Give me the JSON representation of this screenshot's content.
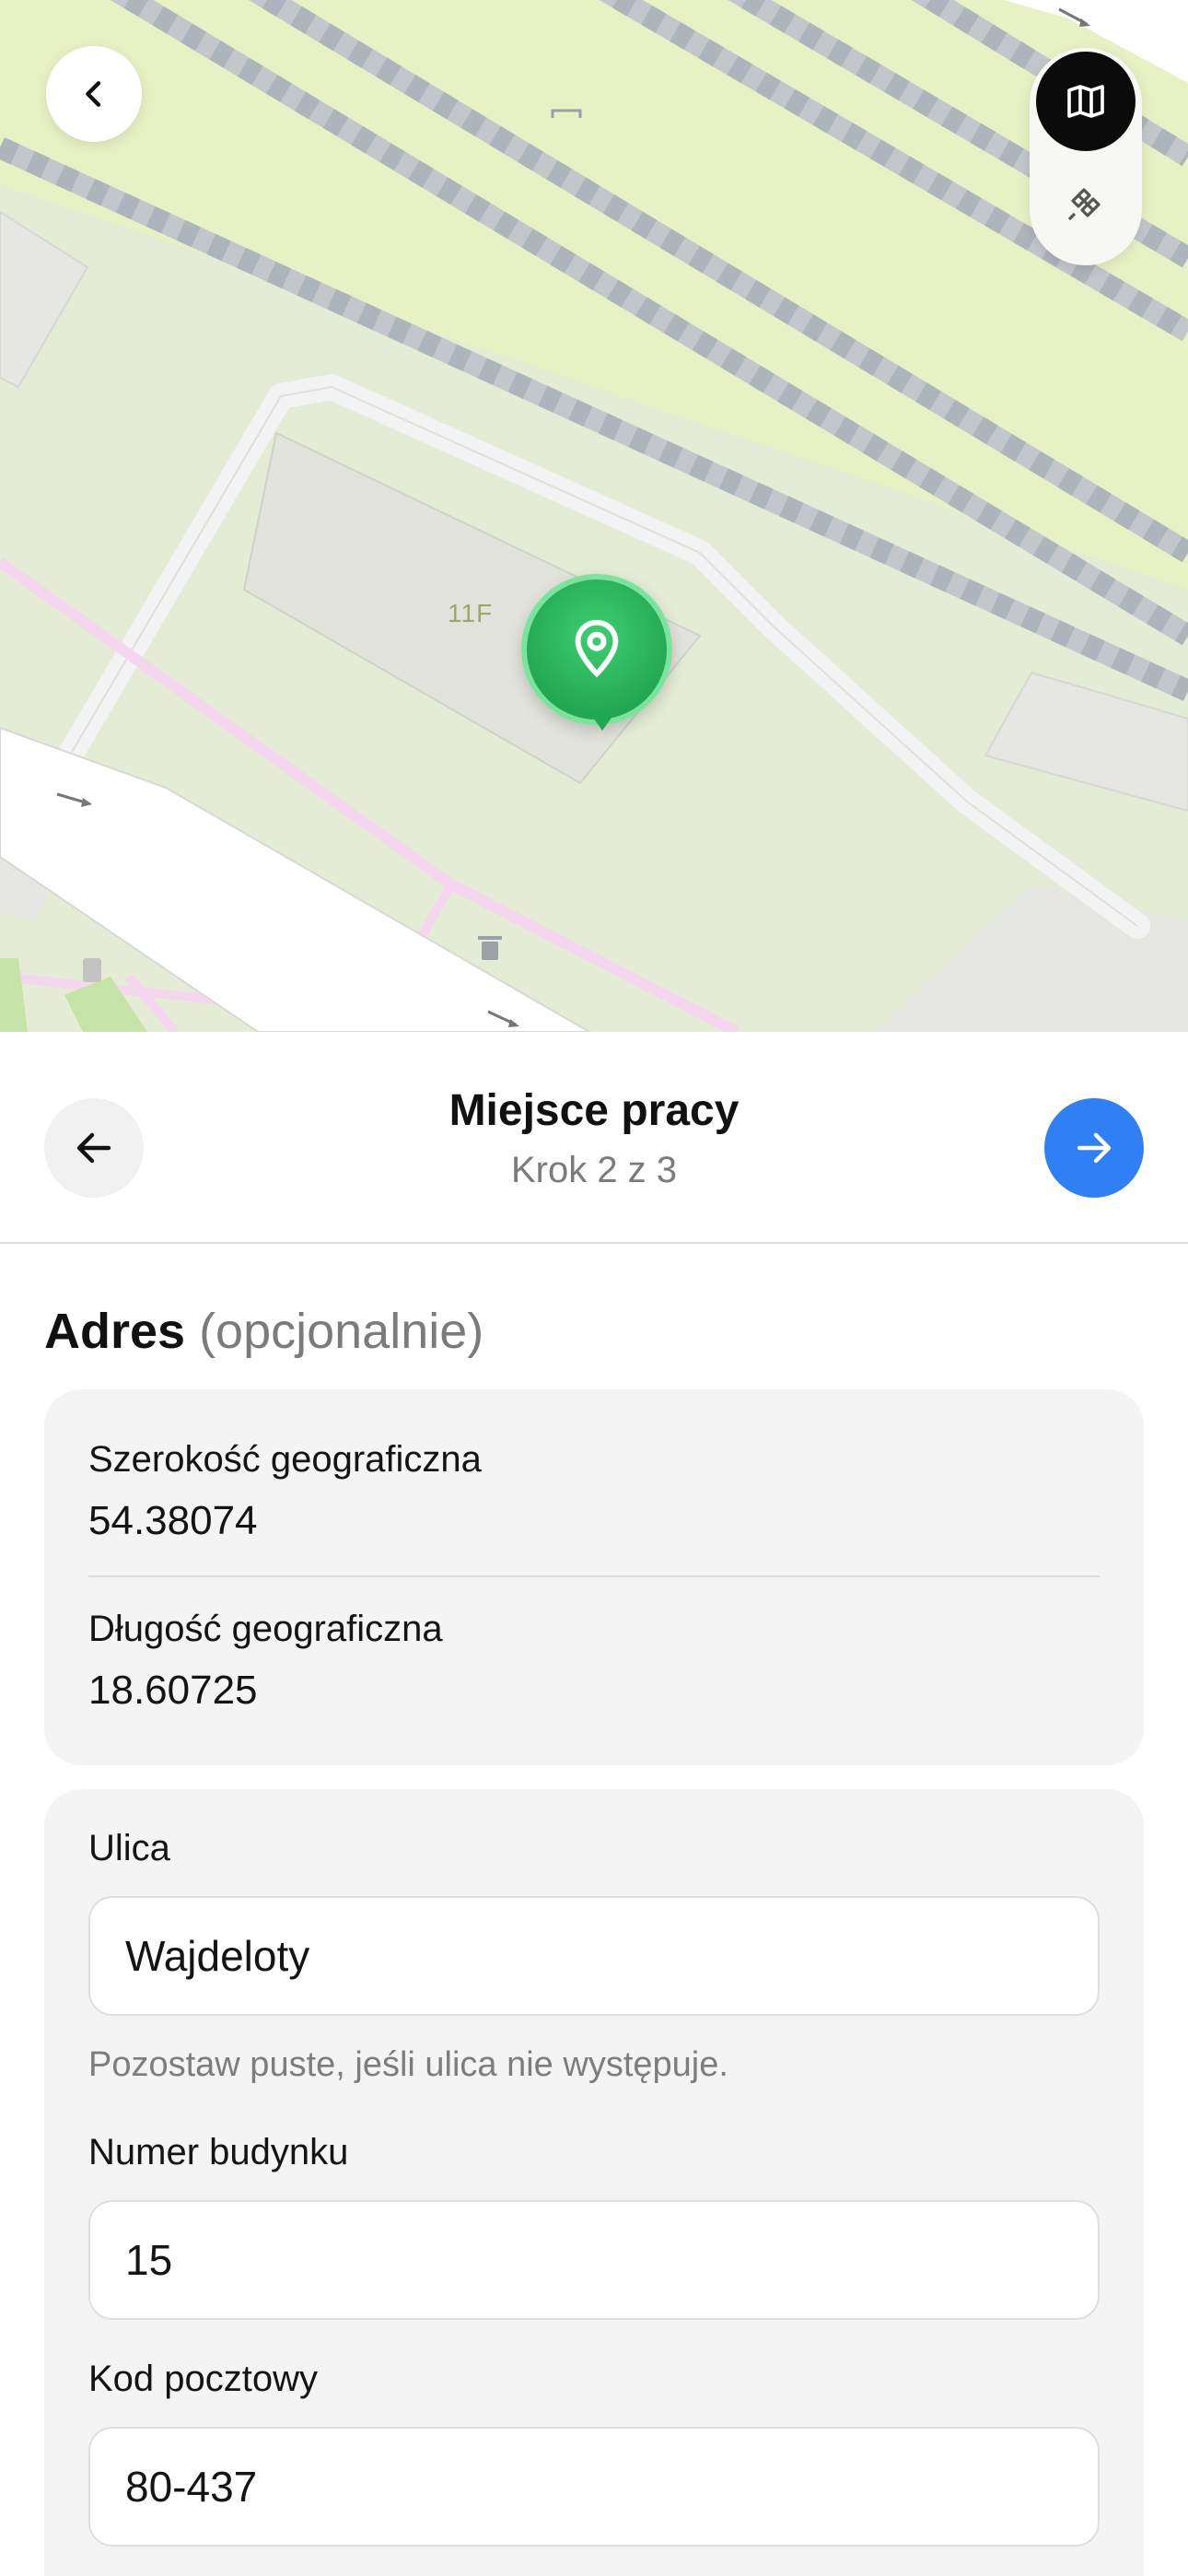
{
  "map": {
    "building_label": "11F",
    "back_icon": "chevron-left-icon",
    "layer_map_icon": "map-icon",
    "layer_satellite_icon": "satellite-icon",
    "pin_icon": "location-pin-icon"
  },
  "header": {
    "title": "Miejsce pracy",
    "step": "Krok 2 z 3",
    "prev_icon": "arrow-left-icon",
    "next_icon": "arrow-right-icon",
    "accent_color": "#2f7ff5"
  },
  "section": {
    "title": "Adres",
    "optional": "(opcjonalnie)"
  },
  "coords": {
    "lat_label": "Szerokość geograficzna",
    "lat_value": "54.38074",
    "lng_label": "Długość geograficzna",
    "lng_value": "18.60725"
  },
  "address": {
    "street_label": "Ulica",
    "street_value": "Wajdeloty",
    "street_hint": "Pozostaw puste, jeśli ulica nie występuje.",
    "building_label": "Numer budynku",
    "building_value": "15",
    "postal_label": "Kod pocztowy",
    "postal_value": "80-437"
  }
}
